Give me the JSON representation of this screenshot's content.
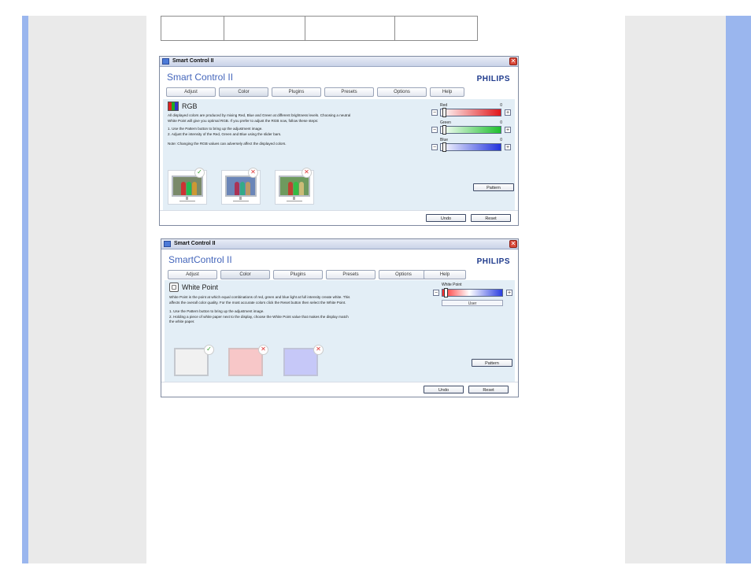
{
  "window1": {
    "title": "Smart Control II",
    "app_title": "Smart Control II",
    "brand": "PHILIPS",
    "tabs": [
      "Adjust",
      "Color",
      "Plugins",
      "Presets",
      "Options",
      "Help"
    ],
    "active_tab": "Color",
    "panel_title": "RGB",
    "description": [
      "All displayed colors are produced by mixing Red, Blue and Green at different brightness levels. Choosing a neutral",
      "White Point will give you optimal RGB. If you prefer to adjust the RGB now, follow these steps:",
      "",
      "1. Use the Pattern button to bring up the adjustment image.",
      "2. Adjust the intensity of the Red, Green and Blue using the slider bars.",
      "",
      "Note: Changing the RGB values can adversely affect the displayed colors."
    ],
    "sliders": [
      {
        "label": "Red",
        "value": "0",
        "color": "#e0171b"
      },
      {
        "label": "Green",
        "value": "0",
        "color": "#1fbf2e"
      },
      {
        "label": "Blue",
        "value": "0",
        "color": "#2233dd"
      }
    ],
    "pattern_button": "Pattern",
    "undo_button": "Undo",
    "reset_button": "Reset"
  },
  "window2": {
    "title": "Smart Control II",
    "app_title": "SmartControl II",
    "brand": "PHILIPS",
    "tabs": [
      "Adjust",
      "Color",
      "Plugins",
      "Presets",
      "Options",
      "Help"
    ],
    "active_tab": "Color",
    "panel_title": "White Point",
    "description": [
      "White Point is the point at which equal combinations of red, green and blue light at full intensity create white. This",
      "affects the overall color quality. For the most accurate colors click the Reset button then select the White Point.",
      "",
      "1. Use the Pattern button to bring up the adjustment image.",
      "2. Holding a piece of white paper next to the display, choose the White Point value that makes the display match",
      "the white paper."
    ],
    "slider": {
      "label": "White Point",
      "mode": "User"
    },
    "pattern_button": "Pattern",
    "undo_button": "Undo",
    "reset_button": "Reset"
  },
  "icons": {
    "close": "close-icon",
    "check": "check-icon",
    "cross": "cross-icon",
    "minus": "minus-icon",
    "plus": "plus-icon"
  },
  "glyphs": {
    "close": "✕",
    "check": "✓",
    "cross": "✕",
    "minus": "−",
    "plus": "+"
  }
}
